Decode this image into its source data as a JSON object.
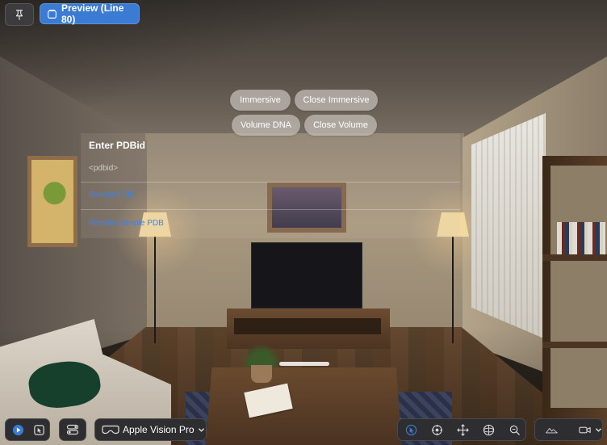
{
  "toolbar": {
    "pin_icon": "pin-icon",
    "preview_label": "Preview (Line 80)"
  },
  "immersive_controls": {
    "immersive_label": "Immersive",
    "close_immersive_label": "Close Immersive",
    "volume_dna_label": "Volume DNA",
    "close_volume_label": "Close Volume"
  },
  "pdb_panel": {
    "title": "Enter PDBid",
    "input_placeholder": "<pdbid>",
    "render_pdb_label": "Render PDB",
    "render_sample_label": "Render Sample PDB",
    "link_color": "#3b82f0"
  },
  "bottom_bar": {
    "device_label": "Apple Vision Pro",
    "device_icon": "vision-pro-headset-icon",
    "accent": "#3b7bd4"
  }
}
